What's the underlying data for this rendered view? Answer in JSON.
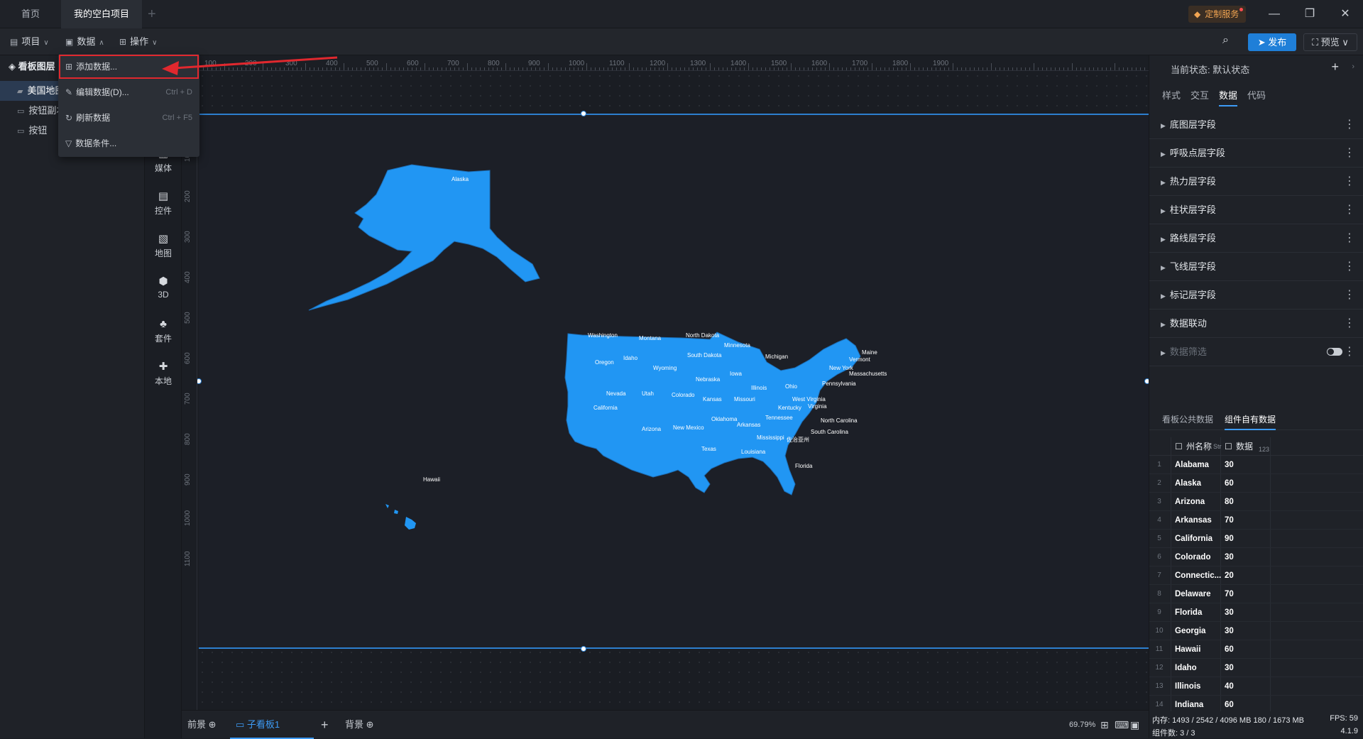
{
  "titlebar": {
    "tabs": [
      {
        "label": "首页"
      },
      {
        "label": "我的空白项目"
      }
    ],
    "service_label": "定制服务"
  },
  "toolbar": {
    "project_label": "项目",
    "data_label": "数据",
    "ops_label": "操作",
    "publish_label": "发布",
    "preview_label": "预览"
  },
  "layers": {
    "header": "看板图层",
    "items": [
      {
        "label": "美国地图"
      },
      {
        "label": "按钮副本"
      },
      {
        "label": "按钮"
      }
    ]
  },
  "components": [
    {
      "label": "媒体"
    },
    {
      "label": "控件"
    },
    {
      "label": "地图"
    },
    {
      "label": "3D"
    },
    {
      "label": "套件"
    },
    {
      "label": "本地"
    }
  ],
  "ruler": {
    "h": [
      "100",
      "200",
      "300",
      "400",
      "500",
      "600",
      "700",
      "800",
      "900",
      "1000",
      "1100",
      "1200",
      "1300",
      "1400",
      "1500",
      "1600",
      "1700",
      "1800",
      "1900"
    ],
    "v": [
      "100",
      "200",
      "300",
      "400",
      "500",
      "600",
      "700",
      "800",
      "900",
      "1000",
      "1100"
    ]
  },
  "dropdown": {
    "items": [
      {
        "label": "添加数据...",
        "shortcut": ""
      },
      {
        "label": "编辑数据(D)...",
        "shortcut": "Ctrl + D"
      },
      {
        "label": "刷新数据",
        "shortcut": "Ctrl + F5"
      },
      {
        "label": "数据条件...",
        "shortcut": ""
      }
    ]
  },
  "map": {
    "states": [
      "Alaska",
      "Hawaii",
      "Washington",
      "Montana",
      "North Dakota",
      "Minnesota",
      "Oregon",
      "Idaho",
      "South Dakota",
      "Wyoming",
      "Michigan",
      "Maine",
      "Vermont",
      "New York",
      "Massachusetts",
      "Iowa",
      "Nebraska",
      "Pennsylvania",
      "Illinois",
      "Ohio",
      "Nevada",
      "Utah",
      "Colorado",
      "Kansas",
      "Missouri",
      "West Virginia",
      "Virginia",
      "Kentucky",
      "California",
      "Tennessee",
      "North Carolina",
      "Oklahoma",
      "Arkansas",
      "Arizona",
      "New Mexico",
      "South Carolina",
      "Mississippi",
      "Texas",
      "Louisiana",
      "Florida",
      "佐治亚州"
    ]
  },
  "bottombar": {
    "front_label": "前景",
    "sub_label": "子看板1",
    "back_label": "背景",
    "zoom": "69.79%"
  },
  "rightpanel": {
    "state": "当前状态:  默认状态",
    "tabs": [
      "样式",
      "交互",
      "数据",
      "代码"
    ],
    "fields": [
      "底图层字段",
      "呼吸点层字段",
      "热力层字段",
      "柱状层字段",
      "路线层字段",
      "飞线层字段",
      "标记层字段",
      "数据联动",
      "数据筛选"
    ],
    "data_tabs": [
      "看板公共数据",
      "组件自有数据"
    ],
    "col_name": "州名称",
    "col_name_type": "Str",
    "col_value": "数据",
    "col_value_type": "123",
    "rows": [
      {
        "n": "1",
        "name": "Alabama",
        "v": "30"
      },
      {
        "n": "2",
        "name": "Alaska",
        "v": "60"
      },
      {
        "n": "3",
        "name": "Arizona",
        "v": "80"
      },
      {
        "n": "4",
        "name": "Arkansas",
        "v": "70"
      },
      {
        "n": "5",
        "name": "California",
        "v": "90"
      },
      {
        "n": "6",
        "name": "Colorado",
        "v": "30"
      },
      {
        "n": "7",
        "name": "Connectic...",
        "v": "20"
      },
      {
        "n": "8",
        "name": "Delaware",
        "v": "70"
      },
      {
        "n": "9",
        "name": "Florida",
        "v": "30"
      },
      {
        "n": "10",
        "name": "Georgia",
        "v": "30"
      },
      {
        "n": "11",
        "name": "Hawaii",
        "v": "60"
      },
      {
        "n": "12",
        "name": "Idaho",
        "v": "30"
      },
      {
        "n": "13",
        "name": "Illinois",
        "v": "40"
      },
      {
        "n": "14",
        "name": "Indiana",
        "v": "60"
      }
    ],
    "status": {
      "mem": "内存:  1493 / 2542 / 4096 MB  180 / 1673 MB",
      "fps": "FPS:  59",
      "count": "组件数: 3 / 3",
      "version": "4.1.9"
    }
  }
}
